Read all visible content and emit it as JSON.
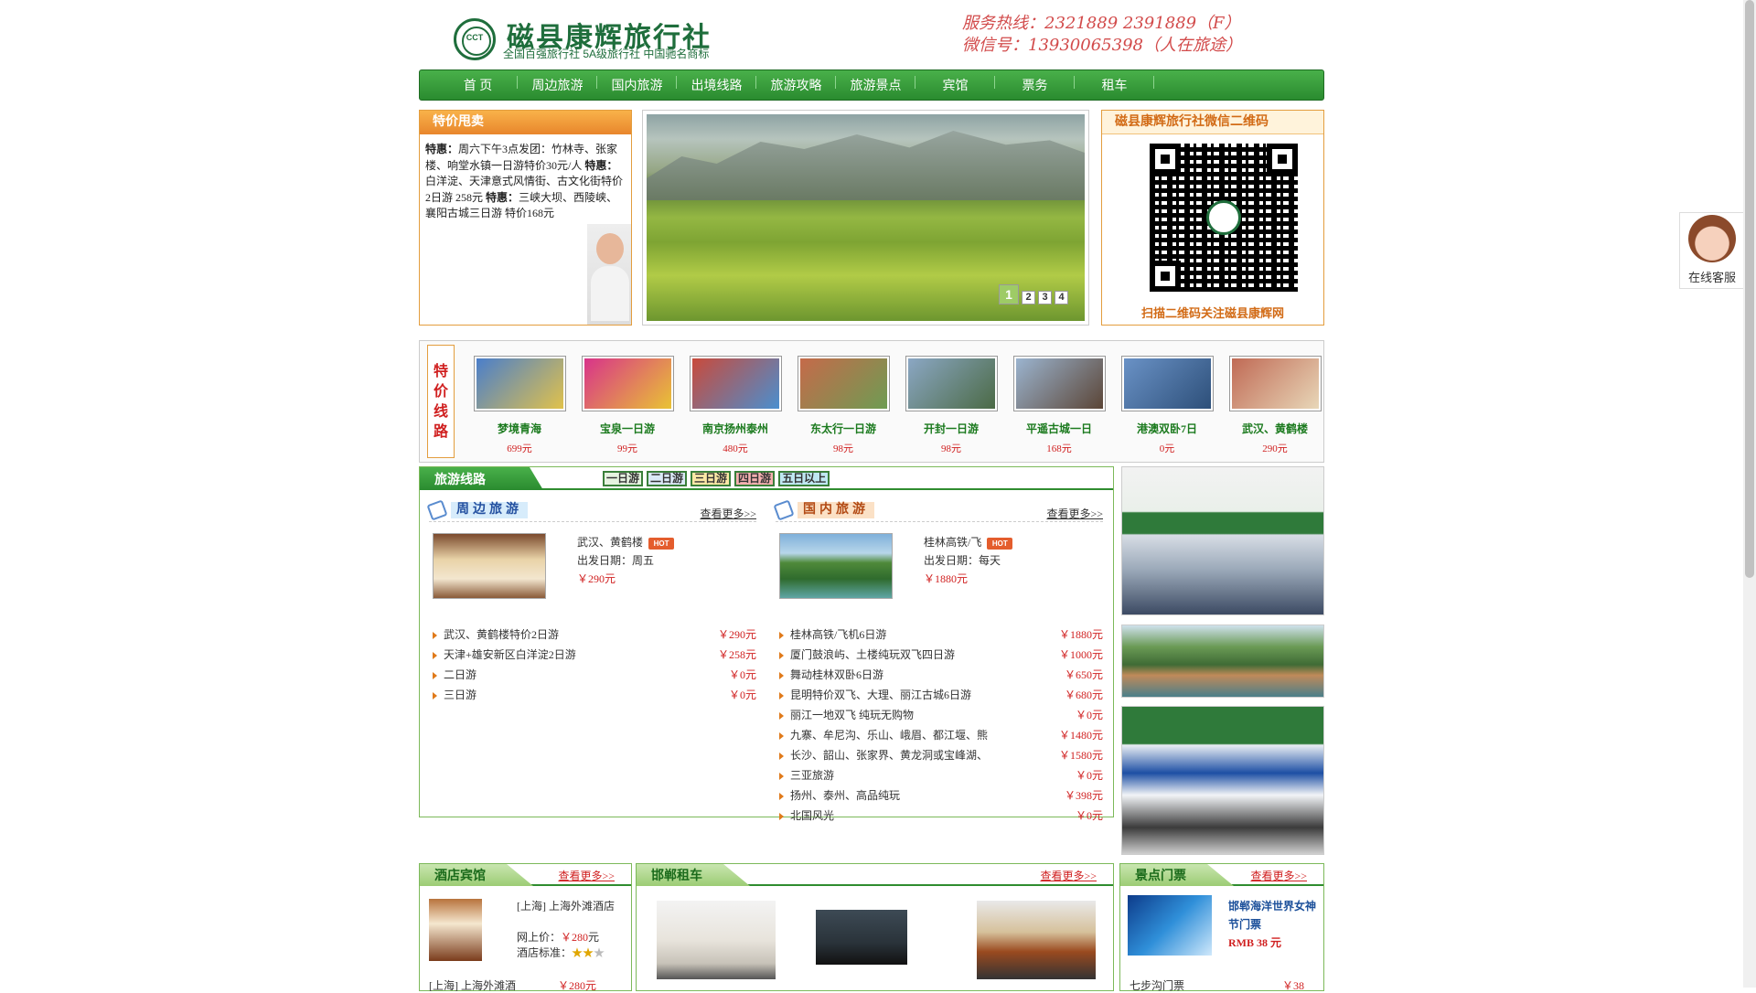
{
  "header": {
    "brand": "磁县康辉旅行社",
    "logo_text": "CCT",
    "subtitle": "全国百强旅行社  5A级旅行社  中国驰名商标",
    "hotline": "服务热线：2321889  2391889（F）",
    "wechat": "微信号：13930065398（人在旅途）"
  },
  "nav": [
    "首 页",
    "周边旅游",
    "国内旅游",
    "出境线路",
    "旅游攻略",
    "旅游景点",
    "宾馆",
    "票务",
    "租车"
  ],
  "special": {
    "title": "特价甩卖",
    "label1": "特惠：",
    "text1": "周六下午3点发团：竹林寺、张家楼、响堂水镇一日游特价30元/人 ",
    "label2": "特惠：",
    "text2": "白洋淀、天津意式风情街、古文化街特价2日游 258元 ",
    "label3": "特惠：",
    "text3": "三峡大坝、西陵峡、襄阳古城三日游 特价168元"
  },
  "banner": {
    "pages": [
      "1",
      "2",
      "3",
      "4"
    ],
    "active": 0
  },
  "qr": {
    "title": "磁县康辉旅行社微信二维码",
    "caption": "扫描二维码关注磁县康辉网"
  },
  "strip": {
    "label": "特价线路",
    "items": [
      {
        "name": "梦境青海",
        "price": "699元",
        "c1": "#4a7ecb",
        "c2": "#e1c24b"
      },
      {
        "name": "宝泉一日游",
        "price": "99元",
        "c1": "#d8338a",
        "c2": "#e9c334"
      },
      {
        "name": "南京扬州泰州",
        "price": "480元",
        "c1": "#c94a3b",
        "c2": "#4a8fcf"
      },
      {
        "name": "东太行一日游",
        "price": "98元",
        "c1": "#c56a4a",
        "c2": "#6e9c53"
      },
      {
        "name": "开封一日游",
        "price": "98元",
        "c1": "#8ba7c4",
        "c2": "#4b6a45"
      },
      {
        "name": "平遥古城一日",
        "price": "168元",
        "c1": "#9bb4cf",
        "c2": "#5b4536"
      },
      {
        "name": "港澳双卧7日",
        "price": "0元",
        "c1": "#6a92c6",
        "c2": "#2d4f79"
      },
      {
        "name": "武汉、黄鹤楼",
        "price": "290元",
        "c1": "#c06a55",
        "c2": "#e8d7b8"
      }
    ]
  },
  "routes": {
    "title": "旅游线路",
    "days": [
      "一日游",
      "二日游",
      "三日游",
      "四日游",
      "五日以上"
    ],
    "day_colors": [
      "#e6f3e0",
      "#dbe9f7",
      "#fbe8a6",
      "#f4b0b0",
      "#bfe7f1"
    ],
    "hot_label": "HOT",
    "more": "查看更多>>",
    "nearby": {
      "title": "周边旅游",
      "feature": {
        "name": "武汉、黄鹤楼",
        "date": "出发日期：周五",
        "price": "￥290元"
      },
      "list": [
        {
          "name": "武汉、黄鹤楼特价2日游",
          "price": "￥290元"
        },
        {
          "name": "天津+雄安新区白洋淀2日游",
          "price": "￥258元"
        },
        {
          "name": "二日游",
          "price": "￥0元"
        },
        {
          "name": "三日游",
          "price": "￥0元"
        }
      ]
    },
    "domestic": {
      "title": "国内旅游",
      "feature": {
        "name": "桂林高铁/飞",
        "date": "出发日期：每天",
        "price": "￥1880元"
      },
      "list": [
        {
          "name": "桂林高铁/飞机6日游",
          "price": "￥1880元"
        },
        {
          "name": "厦门鼓浪屿、土楼纯玩双飞四日游",
          "price": "￥1000元"
        },
        {
          "name": "舞动桂林双卧6日游",
          "price": "￥650元"
        },
        {
          "name": "昆明特价双飞、大理、丽江古城6日游",
          "price": "￥680元"
        },
        {
          "name": "丽江一地双飞 纯玩无购物",
          "price": "￥0元"
        },
        {
          "name": "九寨、牟尼沟、乐山、峨眉、都江堰、熊",
          "price": "￥1480元"
        },
        {
          "name": "长沙、韶山、张家界、黄龙洞或宝峰湖、",
          "price": "￥1580元"
        },
        {
          "name": "三亚旅游",
          "price": "￥0元"
        },
        {
          "name": "扬州、泰州、高品纯玩",
          "price": "￥398元"
        },
        {
          "name": "北国风光",
          "price": "￥0元"
        }
      ]
    }
  },
  "hotel": {
    "title": "酒店宾馆",
    "more": "查看更多>>",
    "name": "[上海] 上海外滩酒店",
    "price_label": "网上价：",
    "price": "￥280",
    "price_unit": "元",
    "grade_label": "酒店标准：",
    "row2_name": "[上海] 上海外滩酒",
    "row2_price": "￥280元"
  },
  "car": {
    "title": "邯郸租车",
    "more": "查看更多>>"
  },
  "ticket": {
    "title": "景点门票",
    "more": "查看更多>>",
    "name": "邯郸海洋世界女神节门票",
    "price": "RMB 38 元",
    "row2_name": "七步沟门票",
    "row2_price": "￥38"
  },
  "online": {
    "label": "在线客服"
  }
}
